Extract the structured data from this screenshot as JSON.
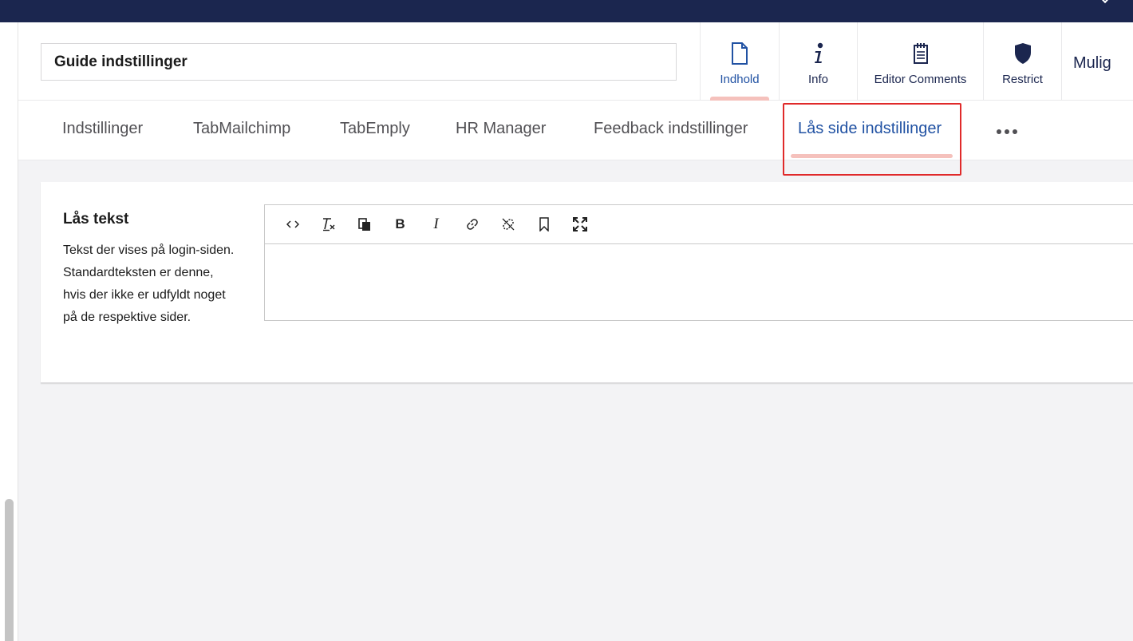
{
  "page": {
    "name_value": "Guide indstillinger"
  },
  "app_nav": {
    "items": [
      {
        "label": "Indhold",
        "icon": "document-icon",
        "active": true
      },
      {
        "label": "Info",
        "icon": "info-icon",
        "active": false
      },
      {
        "label": "Editor Comments",
        "icon": "notepad-icon",
        "active": false
      },
      {
        "label": "Restrict",
        "icon": "shield-icon",
        "active": false
      }
    ],
    "overflow_label": "Mulig"
  },
  "tabs": {
    "items": [
      {
        "label": "Indstillinger"
      },
      {
        "label": "TabMailchimp"
      },
      {
        "label": "TabEmply"
      },
      {
        "label": "HR Manager"
      },
      {
        "label": "Feedback indstillinger"
      },
      {
        "label": "Lås side indstillinger"
      }
    ],
    "active_index": 5,
    "more_icon": "ellipsis-icon"
  },
  "property": {
    "label": "Lås tekst",
    "description": "Tekst der vises på login-siden. Standardteksten er denne, hvis der ikke er udfyldt noget på de respektive sider."
  },
  "editor": {
    "toolbar_icons": [
      "code-icon",
      "clear-format-icon",
      "paste-icon",
      "bold-icon",
      "italic-icon",
      "link-icon",
      "unlink-icon",
      "bookmark-icon",
      "fullscreen-icon"
    ],
    "bold_glyph": "B",
    "italic_glyph": "I",
    "content": ""
  },
  "colors": {
    "topbar": "#1b264f",
    "active_blue": "#2152a3",
    "tab_indicator": "#f5c1bc",
    "highlight_red": "#e02a2a"
  }
}
